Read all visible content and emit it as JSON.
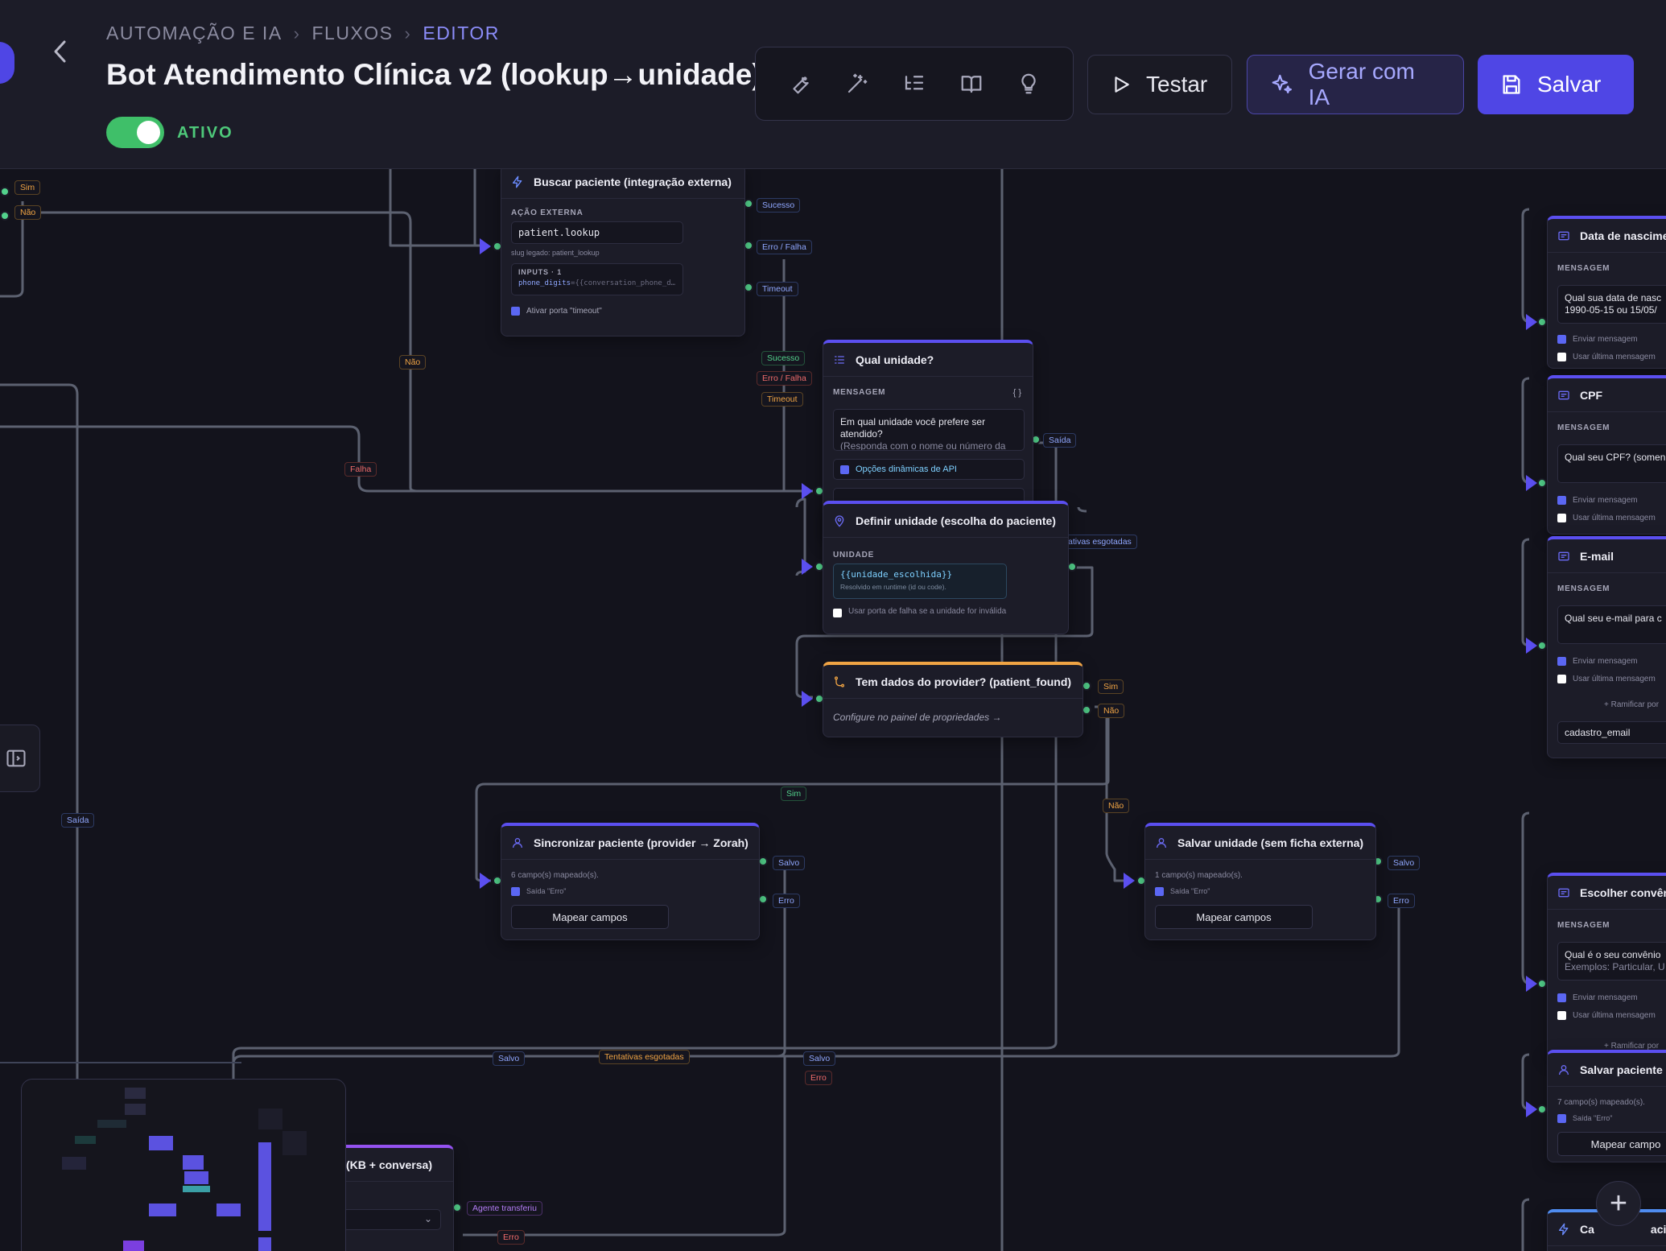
{
  "header": {
    "breadcrumb": [
      "AUTOMAÇÃO E IA",
      "FLUXOS",
      "EDITOR"
    ],
    "title": "Bot Atendimento Clínica v2 (lookup→unidade)",
    "status": "ATIVO",
    "tools": [
      "wrench-icon",
      "magic-wand-icon",
      "list-tree-icon",
      "book-icon",
      "lightbulb-icon"
    ],
    "test_label": "Testar",
    "ai_label": "Gerar com IA",
    "save_label": "Salvar"
  },
  "colors": {
    "accent": "#4f46e5",
    "success": "#53d28c",
    "danger": "#ef6b6b",
    "warning": "#f0a444",
    "active": "#3fbf69"
  },
  "edges": {
    "sim": "Sim",
    "nao": "Não",
    "sucesso": "Sucesso",
    "erro_falha": "Erro / Falha",
    "timeout": "Timeout",
    "falha": "Falha",
    "saida": "Saída",
    "salvo": "Salvo",
    "erro": "Erro",
    "tentativas": "Tentativas esgotadas",
    "tentativas_partial": "ativas esgotadas",
    "agente": "Agente transferiu"
  },
  "nodes": {
    "buscar": {
      "title": "Buscar paciente (integração externa)",
      "action_label": "AÇÃO EXTERNA",
      "action_value": "patient.lookup",
      "legacy": "slug legado: patient_lookup",
      "inputs_label": "INPUTS · 1",
      "input_key": "phone_digits",
      "input_value": "={{conversation_phone_d…",
      "timeout_check": "Ativar porta \"timeout\""
    },
    "qual_unidade": {
      "title": "Qual unidade?",
      "msg_label": "MENSAGEM",
      "braces": "{ }",
      "message": "Em qual unidade você prefere ser atendido?",
      "message_cut": "(Responda com o nome ou número da",
      "api_check": "Opções dinâmicas de API"
    },
    "definir_unidade": {
      "title": "Definir unidade (escolha do paciente)",
      "unit_label": "UNIDADE",
      "unit_value": "{{unidade_escolhida}}",
      "unit_hint": "Resolvido em runtime (id ou code).",
      "fail_check": "Usar porta de falha se a unidade for inválida"
    },
    "tem_dados": {
      "title": "Tem dados do provider? (patient_found)",
      "hint": "Configure no painel de propriedades →"
    },
    "sincronizar": {
      "title": "Sincronizar paciente (provider → Zorah)",
      "mapped": "6 campo(s) mapeado(s).",
      "check": "Saída \"Erro\"",
      "button": "Mapear campos"
    },
    "salvar_unidade": {
      "title": "Salvar unidade (sem ficha externa)",
      "mapped": "1 campo(s) mapeado(s).",
      "check": "Saída \"Erro\"",
      "button": "Mapear campos"
    },
    "kb": {
      "title": "(KB + conversa)"
    },
    "data_nasc": {
      "title": "Data de nascime",
      "msg_label": "MENSAGEM",
      "message": "Qual sua data de nasc",
      "message2": "1990-05-15 ou 15/05/",
      "send_check": "Enviar mensagem",
      "last_check": "Usar última mensagem"
    },
    "cpf": {
      "title": "CPF",
      "msg_label": "MENSAGEM",
      "message": "Qual seu CPF? (somen",
      "send_check": "Enviar mensagem",
      "last_check": "Usar última mensagem"
    },
    "email": {
      "title": "E-mail",
      "msg_label": "MENSAGEM",
      "message": "Qual seu e-mail para c",
      "send_check": "Enviar mensagem",
      "last_check": "Usar última mensagem",
      "branch": "+ Ramificar por",
      "variable": "cadastro_email"
    },
    "convenio": {
      "title": "Escolher convên",
      "msg_label": "MENSAGEM",
      "message": "Qual é o seu convênio",
      "message_cut": "Exemplos: Particular, U",
      "send_check": "Enviar mensagem",
      "last_check": "Usar última mensagem",
      "branch": "+ Ramificar por"
    },
    "salvar_paciente": {
      "title": "Salvar paciente",
      "mapped": "7 campo(s) mapeado(s).",
      "check": "Saída \"Erro\"",
      "button": "Mapear campo"
    },
    "bottom_right": {
      "title": "Ca",
      "title2": "acie"
    }
  },
  "zoom": {
    "in_label": "+"
  }
}
